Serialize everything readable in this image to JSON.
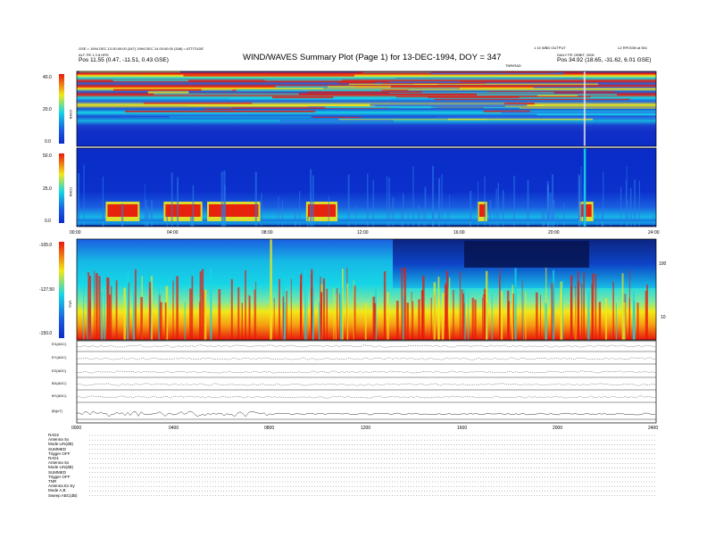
{
  "header": {
    "title": "WIND/WAVES Summary Plot (Page 1) for 13-DEC-1994, DOY = 347",
    "left_line1": "GSE = 1994 DEC 13 00:00:00 (347) 1994 DEC 14 00:00:00 (348) = ATTITUDE",
    "left_line2": "ALT: PE 1.3 8 HRS",
    "left_pos": "Pos 11.55 (0.47, -11.51, 0.43 GSE)",
    "right_line1": "1 10 WBD OUTPUT",
    "right_line2": "DAILY PE ORBIT, 2005",
    "right_pos": "Pos 34.92 (18.65, -31.62, 6.01 GSE)",
    "right_corner": "LZ RPOOM at 501",
    "tnr_note": "TNR/RAD"
  },
  "chart_data": [
    {
      "type": "heatmap",
      "name": "RAD2",
      "ylabel": "RAD2",
      "ylim": [
        0.0,
        40.0
      ],
      "yticks": [
        "40.0",
        "20.0",
        "0.0"
      ],
      "xlim": [
        0,
        24
      ]
    },
    {
      "type": "heatmap",
      "name": "RAD1",
      "ylabel": "RAD1",
      "ylim": [
        0.0,
        50.0
      ],
      "yticks": [
        "50.0",
        "25.0",
        "0.0"
      ],
      "xticks": [
        "00:00",
        "04:00",
        "08:00",
        "12:00",
        "16:00",
        "20:00",
        "24:00"
      ],
      "xlim": [
        0,
        24
      ]
    },
    {
      "type": "heatmap",
      "name": "TNR",
      "ylabel": "TNR",
      "ylim": [
        -150.0,
        -105.0
      ],
      "yticks": [
        "-105.0",
        "-127.50",
        "-150.0"
      ],
      "right_ticks": [
        "100",
        "10"
      ],
      "xlim": [
        0,
        24
      ]
    },
    {
      "type": "line",
      "name": "housekeeping",
      "rows": [
        "EX(ADC)",
        "EY(ADC)",
        "EZ(ADC)",
        "BX(ADC)",
        "BY(ADC)",
        "|B|(nT)"
      ],
      "xticks": [
        "0000",
        "0400",
        "0800",
        "1200",
        "1600",
        "2000",
        "2400"
      ],
      "xlim": [
        0,
        24
      ]
    }
  ],
  "legend_block": [
    "RAD2",
    "Antenna Sx",
    "Mode LIN(dB)",
    "SUMMED",
    "Trigger OFF",
    "RAD1",
    "Antenna Sx",
    "Mode LIN(dB)",
    "SUMMED",
    "Trigger OFF",
    "TNR",
    "Antenna Ex Ey",
    "Mode A,B",
    "Sweep ABC(dB)"
  ],
  "colors": {
    "cold": "#0a2cc8",
    "cyan": "#16d6e6",
    "yellow": "#f2e818",
    "hot": "#e8180c"
  }
}
